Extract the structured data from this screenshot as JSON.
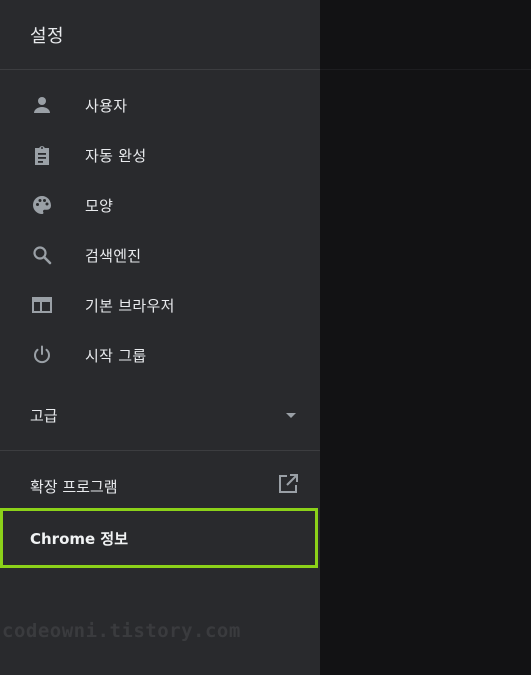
{
  "header": {
    "title": "설정"
  },
  "menu": [
    {
      "label": "사용자",
      "icon": "person-icon"
    },
    {
      "label": "자동 완성",
      "icon": "clipboard-icon"
    },
    {
      "label": "모양",
      "icon": "palette-icon"
    },
    {
      "label": "검색엔진",
      "icon": "search-icon"
    },
    {
      "label": "기본 브라우저",
      "icon": "browser-window-icon"
    },
    {
      "label": "시작 그룹",
      "icon": "power-icon"
    }
  ],
  "advanced": {
    "label": "고급",
    "icon": "caret-down-icon"
  },
  "extensions": {
    "label": "확장 프로그램",
    "icon": "open-in-new-icon"
  },
  "about": {
    "label": "Chrome 정보"
  },
  "watermark": {
    "text": "codeowni.tistory.com"
  },
  "colors": {
    "drawer_bg": "#292a2d",
    "page_bg": "#121214",
    "text": "#e8eaed",
    "icon": "#9aa0a6",
    "highlight_border": "#8bd119"
  }
}
